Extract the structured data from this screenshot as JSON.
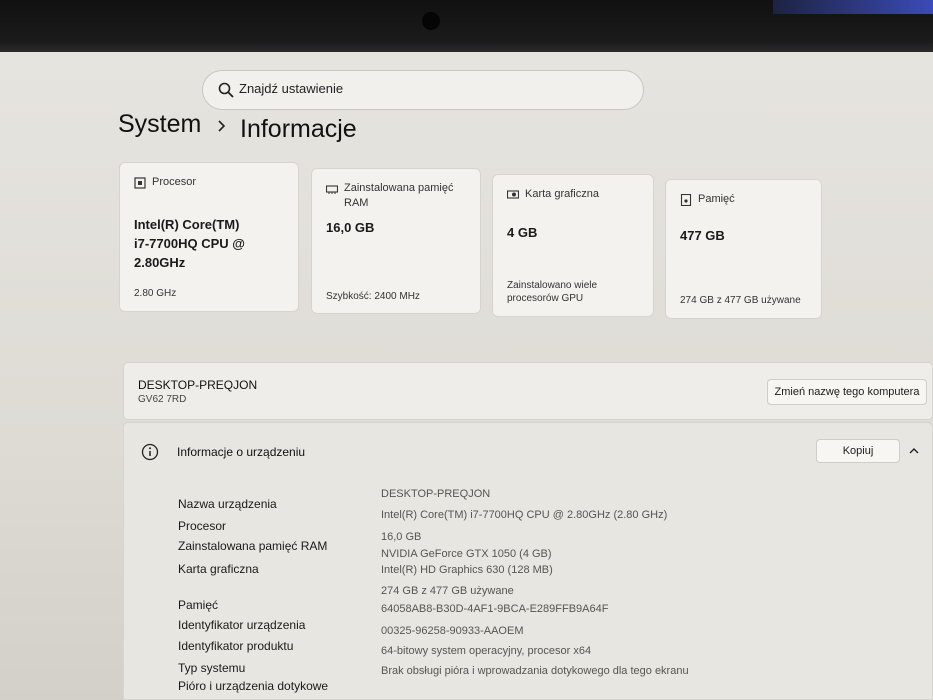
{
  "search": {
    "placeholder": "Znajdź ustawienie"
  },
  "breadcrumb": {
    "parent": "System",
    "current": "Informacje"
  },
  "cards": {
    "cpu": {
      "label": "Procesor",
      "value_lines": [
        "Intel(R) Core(TM)",
        "i7-7700HQ CPU @",
        "2.80GHz"
      ],
      "sub": "2.80 GHz"
    },
    "ram": {
      "label_lines": [
        "Zainstalowana pamięć",
        "RAM"
      ],
      "value": "16,0 GB",
      "sub": "Szybkość: 2400 MHz"
    },
    "gpu": {
      "label": "Karta graficzna",
      "value": "4 GB",
      "sub_lines": [
        "Zainstalowano wiele",
        "procesorów GPU"
      ]
    },
    "storage": {
      "label": "Pamięć",
      "value": "477 GB",
      "sub": "274 GB z 477 GB używane"
    }
  },
  "device_name_panel": {
    "name": "DESKTOP-PREQJON",
    "model": "GV62 7RD",
    "rename_button": "Zmień nazwę tego komputera"
  },
  "device_info": {
    "title": "Informacje o urządzeniu",
    "copy_button": "Kopiuj",
    "rows": [
      {
        "label": "Nazwa urządzenia",
        "value": "DESKTOP-PREQJON"
      },
      {
        "label": "Procesor",
        "value": "Intel(R) Core(TM) i7-7700HQ CPU @ 2.80GHz (2.80 GHz)"
      },
      {
        "label": "Zainstalowana pamięć RAM",
        "value": "16,0 GB"
      },
      {
        "label": "Karta graficzna",
        "value": "NVIDIA GeForce GTX 1050 (4 GB)",
        "value2": "Intel(R) HD Graphics 630 (128 MB)"
      },
      {
        "label": "Pamięć",
        "value": "274 GB z 477 GB używane"
      },
      {
        "label": "Identyfikator urządzenia",
        "value": "64058AB8-B30D-4AF1-9BCA-E289FFB9A64F"
      },
      {
        "label": "Identyfikator produktu",
        "value": "00325-96258-90933-AAOEM"
      },
      {
        "label": "Typ systemu",
        "value": "64-bitowy system operacyjny, procesor x64"
      },
      {
        "label": "Pióro i urządzenia dotykowe",
        "value": "Brak obsługi pióra i wprowadzania dotykowego dla tego ekranu"
      }
    ]
  },
  "icons": {
    "search": "search-icon",
    "chevron_right": "chevron-right-icon",
    "cpu": "cpu-icon",
    "ram": "ram-icon",
    "gpu": "gpu-icon",
    "storage": "storage-icon",
    "info": "info-icon",
    "chevron_up": "chevron-up-icon"
  }
}
